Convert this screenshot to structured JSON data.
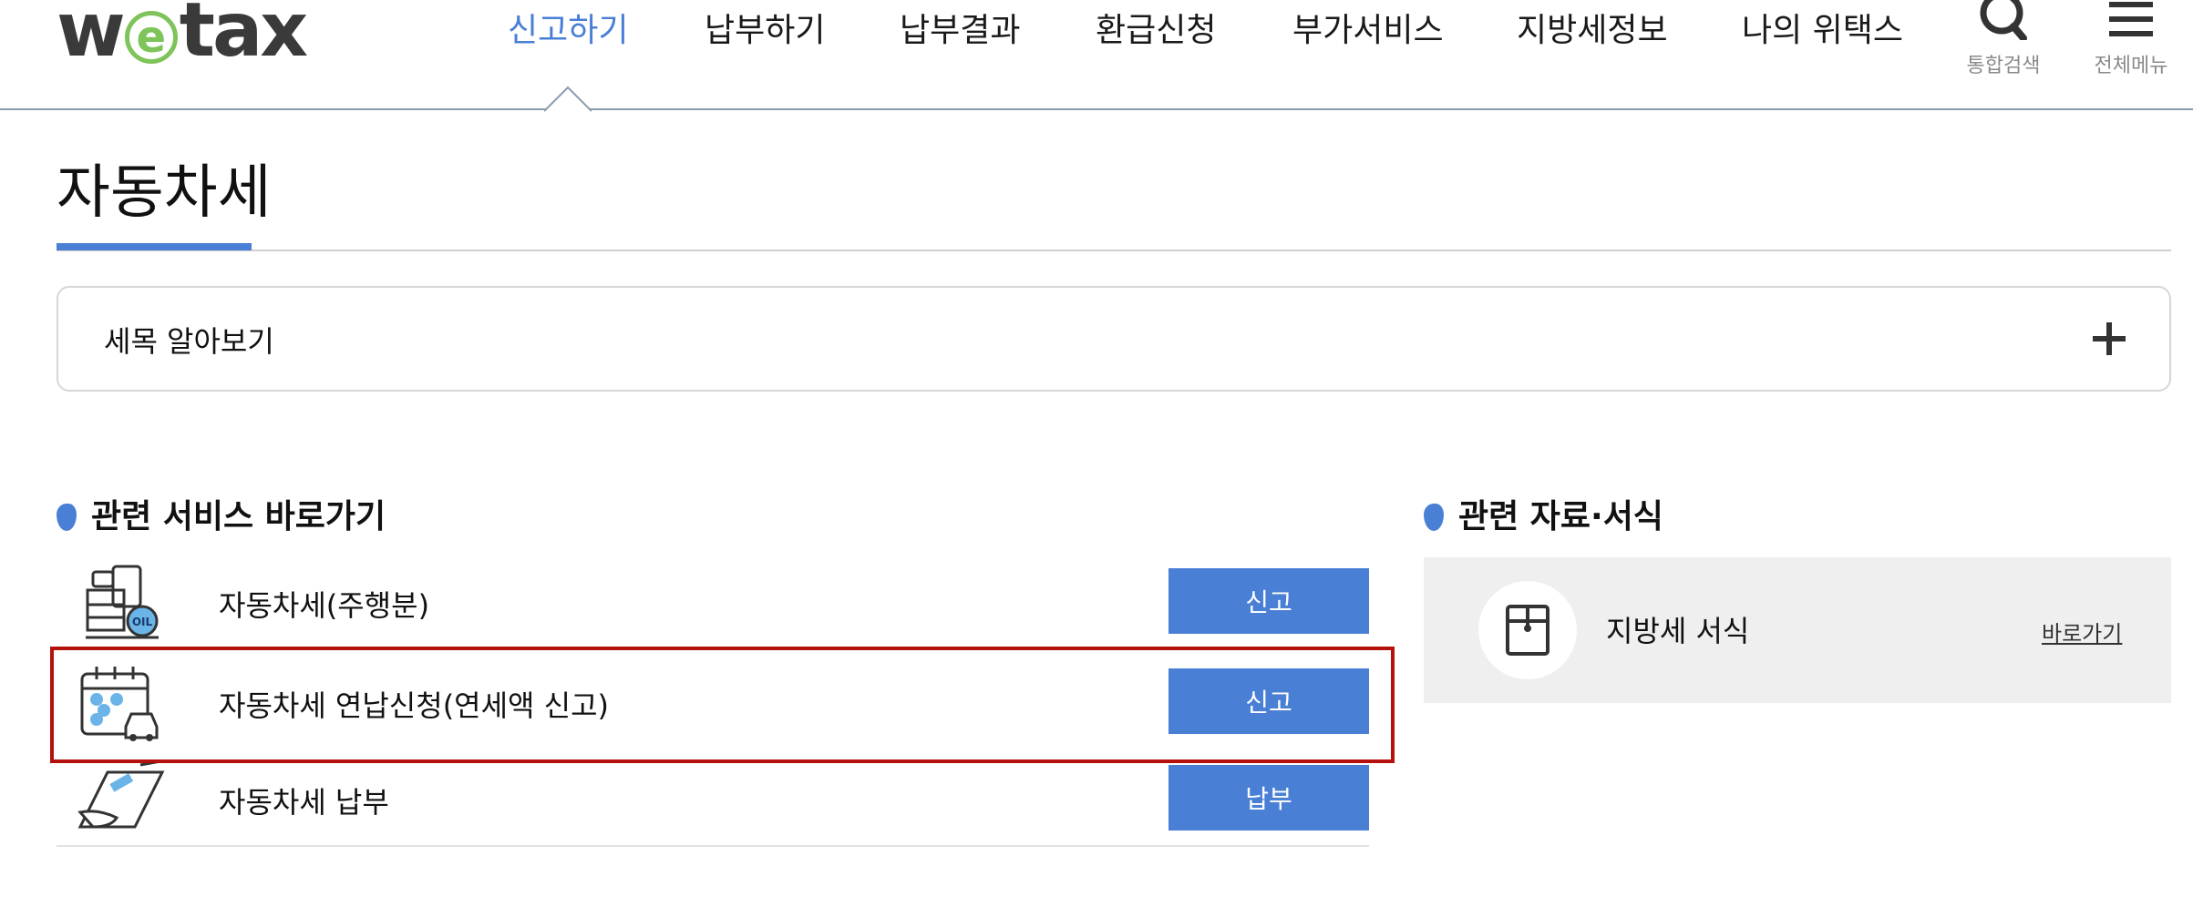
{
  "header": {
    "logo": {
      "left": "w",
      "middle": "e",
      "right": "tax"
    },
    "nav": [
      {
        "label": "신고하기",
        "active": true
      },
      {
        "label": "납부하기"
      },
      {
        "label": "납부결과"
      },
      {
        "label": "환급신청"
      },
      {
        "label": "부가서비스"
      },
      {
        "label": "지방세정보"
      },
      {
        "label": "나의 위택스"
      }
    ],
    "search_label": "통합검색",
    "menu_label": "전체메뉴"
  },
  "page": {
    "title": "자동차세"
  },
  "accordion": {
    "label": "세목 알아보기"
  },
  "services": {
    "heading": "관련 서비스 바로가기",
    "items": [
      {
        "label": "자동차세(주행분)",
        "button": "신고",
        "icon": "oil-tank-icon"
      },
      {
        "label": "자동차세 연납신청(연세액 신고)",
        "button": "신고",
        "icon": "calendar-car-icon"
      },
      {
        "label": "자동차세 납부",
        "button": "납부",
        "icon": "card-payment-icon"
      }
    ]
  },
  "resources": {
    "heading": "관련 자료·서식",
    "item_label": "지방세 서식",
    "link": "바로가기",
    "icon": "document-envelope-icon"
  },
  "colors": {
    "accent": "#4a7fd6",
    "logo_e": "#7ec45a",
    "highlight": "#b4110d"
  }
}
